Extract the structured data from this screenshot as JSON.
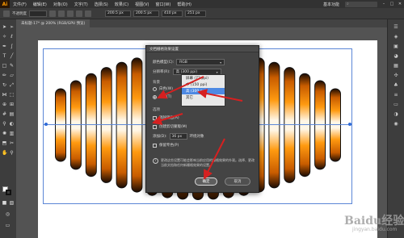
{
  "app": {
    "logo": "Ai",
    "workspace": "基本功能",
    "search_placeholder": ""
  },
  "menu": [
    "文件(F)",
    "编辑(E)",
    "对象(O)",
    "文字(T)",
    "选择(S)",
    "效果(C)",
    "视图(V)",
    "窗口(W)",
    "帮助(H)"
  ],
  "control_bar": {
    "selection_label": "不透明度",
    "width": "200.5 px",
    "height": "200.5 px",
    "x": "410 px",
    "y": "251 px"
  },
  "document_tab": "未标题-17* @ 200% (RGB/GPU 预览)",
  "dialog": {
    "title": "文档栅格效果设置",
    "color_model_label": "颜色模型(C):",
    "color_model_value": "RGB",
    "resolution_label": "分辨率(R):",
    "resolution_value": "高 (300 ppi)",
    "background_label": "背景",
    "bg_white": "白色(W)",
    "bg_transparent": "透明(T)",
    "options_label": "选项",
    "antialias": "消除锯齿(A)",
    "clipping_mask": "创建剪切蒙版(M)",
    "add_label": "添加(D):",
    "add_value": "36 px",
    "add_suffix": "环绕对象",
    "keep_spot": "保留专色(P)",
    "info_text": "更改这些设置可能会影响当前应用的栅格效果的外观。选择、更改当前文档和任何新栅格效果的设置。",
    "ok": "确定",
    "cancel": "取消"
  },
  "resolution_options": [
    "屏幕 (72 ppi)",
    "中 (150 ppi)",
    "高 (300 ppi)",
    "其它"
  ],
  "resolution_selected_index": 2,
  "watermark": {
    "text": "Baidu经验",
    "sub": "jingyan.baidu.com"
  },
  "colors": {
    "accent": "#ff9a00",
    "selection": "#4d89e3",
    "annotation": "#d62020"
  }
}
